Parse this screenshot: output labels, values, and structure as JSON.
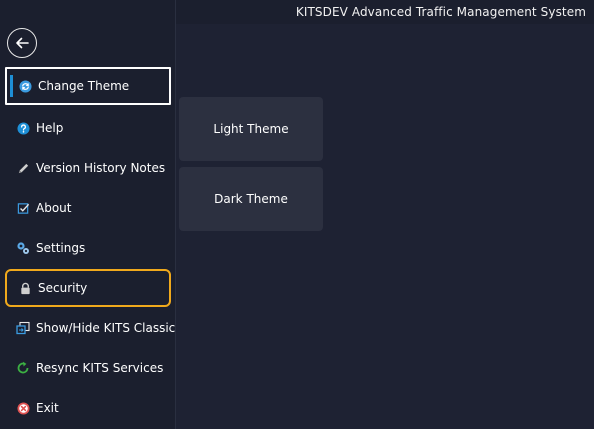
{
  "window": {
    "title": "KITSDEV Advanced Traffic Management System"
  },
  "back_button": {
    "icon": "arrow-left-icon"
  },
  "menu": {
    "items": [
      {
        "label": "Change Theme",
        "icon": "refresh-icon",
        "icon_color": "#3b9be0",
        "state": "selected"
      },
      {
        "label": "Help",
        "icon": "question-circle-icon",
        "icon_color": "#1e8fd6",
        "state": "normal"
      },
      {
        "label": "Version History Notes",
        "icon": "pencil-icon",
        "icon_color": "#cfcfcf",
        "state": "normal"
      },
      {
        "label": "About",
        "icon": "checkbox-icon",
        "icon_color": "#3b9be0",
        "state": "normal"
      },
      {
        "label": "Settings",
        "icon": "gears-icon",
        "icon_color": "#5aa8e6",
        "state": "normal"
      },
      {
        "label": "Security",
        "icon": "lock-icon",
        "icon_color": "#cfcfcf",
        "state": "focused"
      },
      {
        "label": "Show/Hide KITS Classic",
        "icon": "window-toggle-icon",
        "icon_color": "#3b9be0",
        "state": "normal"
      },
      {
        "label": "Resync KITS Services",
        "icon": "resync-icon",
        "icon_color": "#3cb043",
        "state": "normal"
      },
      {
        "label": "Exit",
        "icon": "close-circle-icon",
        "icon_color": "#e05252",
        "state": "normal"
      }
    ]
  },
  "themes": {
    "light_label": "Light Theme",
    "dark_label": "Dark Theme"
  },
  "colors": {
    "sidebar_bg": "#1b1f2e",
    "main_bg": "#1e2233",
    "card_bg": "#2c3040",
    "focus_outline": "#f0a91c",
    "selected_outline": "#ffffff",
    "accent": "#1e8fd6"
  }
}
